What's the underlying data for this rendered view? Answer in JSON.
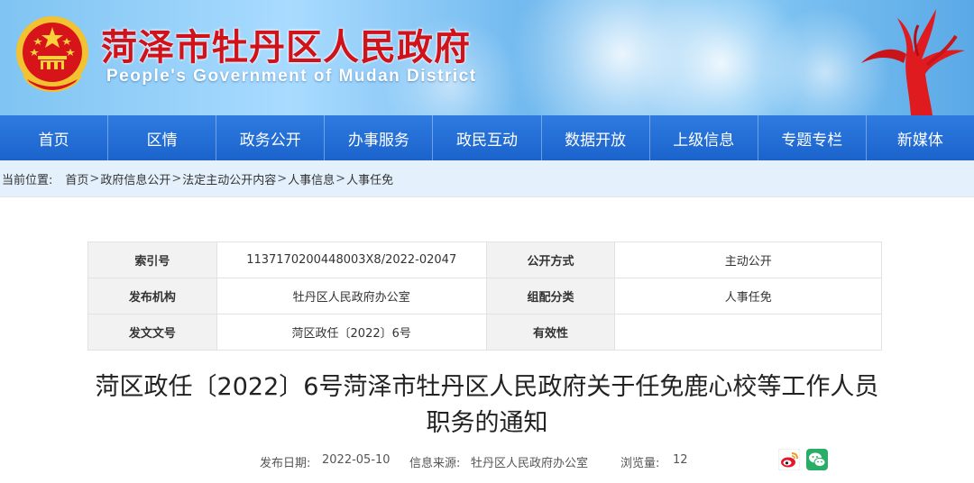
{
  "header": {
    "title": "菏泽市牡丹区人民政府",
    "subtitle": "People's Government of Mudan District",
    "emblem_icon": "national-emblem-icon",
    "sculpture_icon": "red-sculpture-icon"
  },
  "nav": {
    "items": [
      "首页",
      "区情",
      "政务公开",
      "办事服务",
      "政民互动",
      "数据开放",
      "上级信息",
      "专题专栏",
      "新媒体"
    ]
  },
  "breadcrumb": {
    "label": "当前位置:",
    "items": [
      "首页",
      "政府信息公开",
      "法定主动公开内容",
      "人事信息",
      "人事任免"
    ],
    "separator": ">"
  },
  "meta": {
    "index_label": "索引号",
    "index_value": "1137170200448003X8/2022-02047",
    "disclosure_label": "公开方式",
    "disclosure_value": "主动公开",
    "publisher_label": "发布机构",
    "publisher_value": "牡丹区人民政府办公室",
    "category_label": "组配分类",
    "category_value": "人事任免",
    "docno_label": "发文文号",
    "docno_value": "菏区政任〔2022〕6号",
    "validity_label": "有效性",
    "validity_value": ""
  },
  "document": {
    "title_line1": "菏区政任〔2022〕6号菏泽市牡丹区人民政府关于任免鹿心校等工作人员",
    "title_line2": "职务的通知",
    "date_label": "发布日期:",
    "date_value": "2022-05-10",
    "source_label": "信息来源:",
    "source_value": "牡丹区人民政府办公室",
    "views_label": "浏览量:",
    "views_value": "12"
  },
  "share": {
    "weibo_icon": "weibo-icon",
    "wechat_icon": "wechat-icon"
  },
  "colors": {
    "title_red": "#d0121b",
    "nav_blue": "#1f6ad2",
    "crumb_bg": "#e4f1fc",
    "weibo_red": "#e6162d",
    "wechat_green": "#2aae67"
  }
}
